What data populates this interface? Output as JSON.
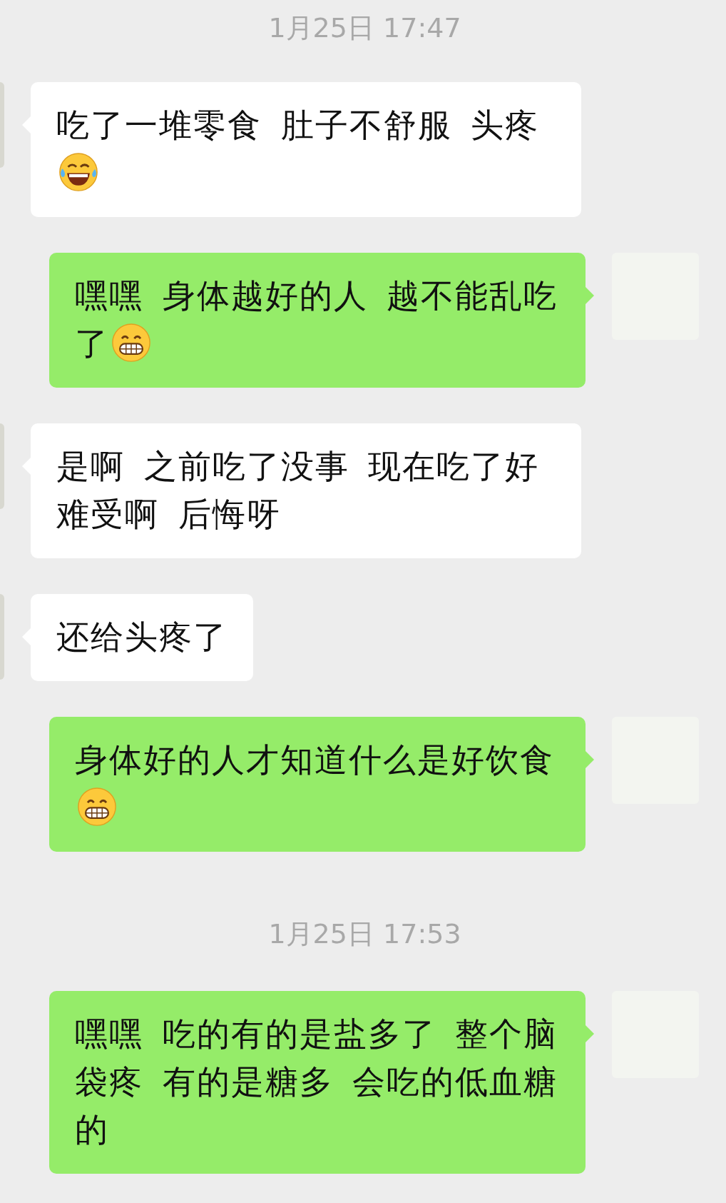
{
  "chat": [
    {
      "kind": "timestamp",
      "text": "1月25日 17:47"
    },
    {
      "kind": "received",
      "text": "吃了一堆零食 肚子不舒服 头疼",
      "emoji": {
        "kind": "tears"
      }
    },
    {
      "kind": "sent",
      "text": "嘿嘿 身体越好的人 越不能乱吃了",
      "emoji": {
        "kind": "grin"
      }
    },
    {
      "kind": "received",
      "text": "是啊 之前吃了没事 现在吃了好难受啊 后悔呀"
    },
    {
      "kind": "received",
      "text": "还给头疼了"
    },
    {
      "kind": "sent",
      "text": "身体好的人才知道什么是好饮食",
      "emoji": {
        "kind": "grin"
      }
    },
    {
      "kind": "timestamp",
      "text": "1月25日 17:53"
    },
    {
      "kind": "sent",
      "text": "嘿嘿 吃的有的是盐多了 整个脑袋疼 有的是糖多 会吃的低血糖的"
    }
  ]
}
